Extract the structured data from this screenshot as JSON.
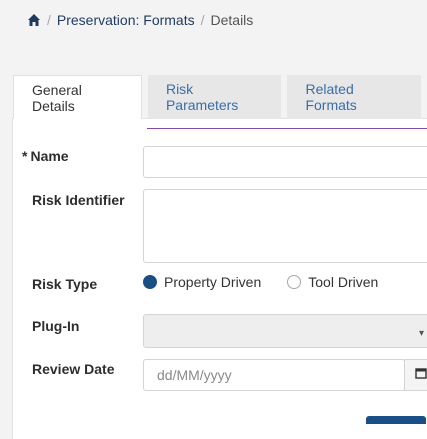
{
  "breadcrumb": {
    "parent": "Preservation: Formats",
    "current": "Details"
  },
  "tabs": [
    {
      "label": "General Details",
      "active": true
    },
    {
      "label": "Risk Parameters",
      "active": false
    },
    {
      "label": "Related Formats",
      "active": false
    }
  ],
  "form": {
    "required_marker": "*",
    "name_label": "Name",
    "name_value": "",
    "risk_identifier_label": "Risk Identifier",
    "risk_identifier_value": "",
    "risk_type_label": "Risk Type",
    "risk_type_options": [
      "Property Driven",
      "Tool Driven"
    ],
    "risk_type_selected": "Property Driven",
    "plugin_label": "Plug-In",
    "review_date_label": "Review Date",
    "review_date_placeholder": "dd/MM/yyyy"
  },
  "colors": {
    "accent": "#1a4f86",
    "tab_underline": "#7e4aa5",
    "link": "#3a6ea5"
  }
}
